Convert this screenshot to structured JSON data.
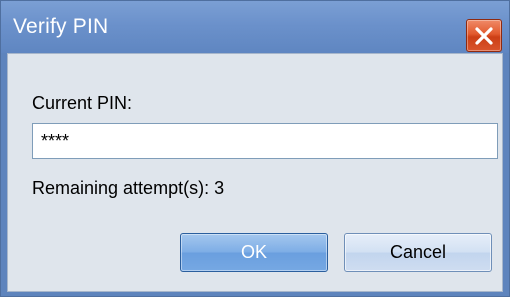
{
  "window": {
    "title": "Verify PIN"
  },
  "form": {
    "pin_label": "Current PIN:",
    "pin_value": "****",
    "remaining_text": "Remaining attempt(s): 3"
  },
  "buttons": {
    "ok_label": "OK",
    "cancel_label": "Cancel"
  },
  "colors": {
    "titlebar": "#6b91cb",
    "client_background": "#dfe5ec",
    "close_button": "#e25a2e",
    "ok_button": "#7eaee6",
    "cancel_button": "#d3e1f3"
  },
  "icons": {
    "close": "close-icon"
  }
}
